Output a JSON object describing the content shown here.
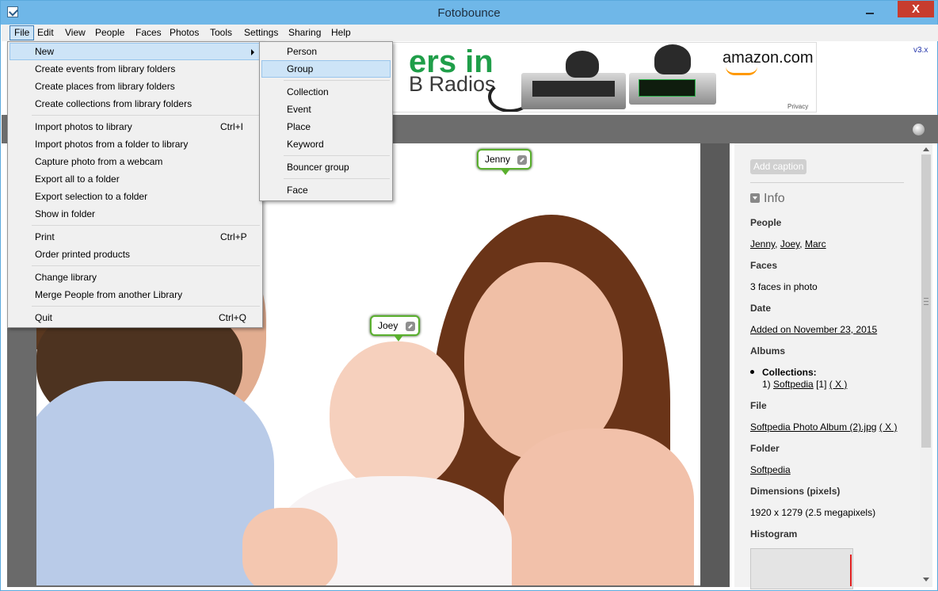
{
  "window": {
    "title": "Fotobounce",
    "close_label": "X"
  },
  "menubar": [
    "File",
    "Edit",
    "View",
    "People",
    "Faces",
    "Photos",
    "Tools",
    "Settings",
    "Sharing",
    "Help"
  ],
  "file_menu": {
    "new_label": "New",
    "items": [
      {
        "label": "Create events from library folders",
        "shortcut": ""
      },
      {
        "label": "Create places from library folders",
        "shortcut": ""
      },
      {
        "label": "Create collections from library folders",
        "shortcut": ""
      },
      {
        "label": "Import photos to library",
        "shortcut": "Ctrl+I"
      },
      {
        "label": "Import photos from a folder to library",
        "shortcut": ""
      },
      {
        "label": "Capture photo from a webcam",
        "shortcut": ""
      },
      {
        "label": "Export all to a folder",
        "shortcut": ""
      },
      {
        "label": "Export selection to a folder",
        "shortcut": ""
      },
      {
        "label": "Show in folder",
        "shortcut": ""
      },
      {
        "label": "Print",
        "shortcut": "Ctrl+P"
      },
      {
        "label": "Order printed products",
        "shortcut": ""
      },
      {
        "label": "Change library",
        "shortcut": ""
      },
      {
        "label": "Merge People from another Library",
        "shortcut": ""
      },
      {
        "label": "Quit",
        "shortcut": "Ctrl+Q"
      }
    ]
  },
  "new_submenu": [
    "Person",
    "Group",
    "Collection",
    "Event",
    "Place",
    "Keyword",
    "Bouncer group",
    "Face"
  ],
  "ad": {
    "headline_1": "ers in",
    "headline_2": "B Radios",
    "brand": "amazon.com",
    "privacy": "Privacy"
  },
  "version": "v3.x",
  "face_tags": [
    "Jenny",
    "Joey"
  ],
  "info_panel": {
    "add_caption": "Add caption",
    "heading": "Info",
    "people_label": "People",
    "people": [
      "Jenny",
      "Joey",
      "Marc"
    ],
    "people_sep": ", ",
    "faces_label": "Faces",
    "faces_value": "3 faces in photo",
    "date_label": "Date",
    "date_value": "Added on November 23, 2015",
    "albums_label": "Albums",
    "collections_label": "Collections:",
    "collection_index": "1)",
    "collection_name": "Softpedia",
    "collection_count": "[1]",
    "remove_label": "( X )",
    "file_label": "File",
    "file_value": "Softpedia Photo Album (2).jpg",
    "folder_label": "Folder",
    "folder_value": "Softpedia",
    "dimensions_label": "Dimensions (pixels)",
    "dimensions_value": "1920 x 1279 (2.5 megapixels)",
    "histogram_label": "Histogram"
  },
  "colors": {
    "titlebar": "#6fb7e8",
    "menu_highlight": "#cde4f7",
    "tag_border": "#5ab02e",
    "close_button": "#c73c2e",
    "ad_green": "#1f9e49",
    "amazon_orange": "#ff9900"
  },
  "icons": [
    "app-icon",
    "minimize-icon",
    "close-icon",
    "submenu-arrow-icon",
    "edit-icon",
    "info-toggle-icon",
    "status-orb-icon",
    "scroll-up-icon",
    "scroll-down-icon"
  ]
}
